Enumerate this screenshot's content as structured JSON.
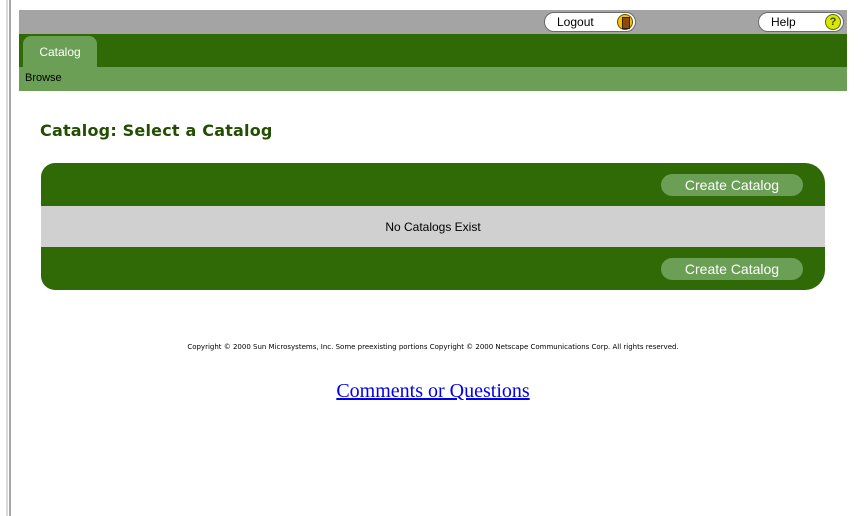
{
  "header": {
    "logout_label": "Logout",
    "help_label": "Help",
    "help_glyph": "?"
  },
  "tabs": [
    {
      "label": "Catalog",
      "active": true
    }
  ],
  "subnav": {
    "items": [
      "Browse"
    ]
  },
  "main": {
    "title": "Catalog: Select a Catalog",
    "create_button_label": "Create Catalog",
    "empty_message": "No Catalogs Exist"
  },
  "footer": {
    "copyright": "Copyright © 2000 Sun Microsystems, Inc. Some preexisting portions Copyright © 2000 Netscape Communications Corp. All rights reserved.",
    "comments_link": "Comments or Questions"
  },
  "colors": {
    "dark_green": "#2f6a07",
    "light_green": "#6a9f55",
    "gray_bar": "#a4a4a4",
    "empty_row": "#d0d0d0",
    "title_green": "#234d00",
    "link": "#0000ee"
  },
  "icons": {
    "logout": "door-icon",
    "help": "question-mark-icon"
  }
}
